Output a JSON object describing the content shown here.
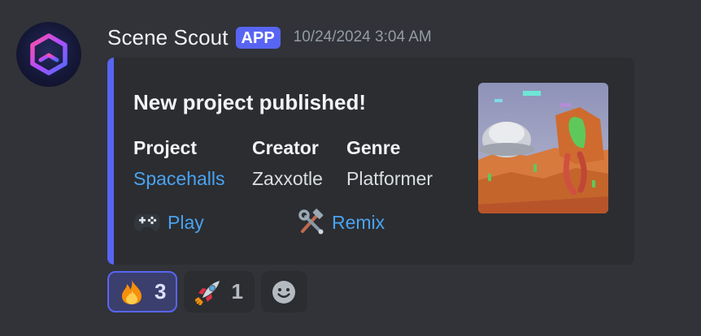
{
  "message": {
    "username": "Scene Scout",
    "badge": "APP",
    "timestamp": "10/24/2024 3:04 AM",
    "avatar_icon": "cube-hexagon-icon"
  },
  "embed": {
    "accent_color": "#5865f2",
    "title": "New project published!",
    "fields": [
      {
        "name": "Project",
        "value": "Spacehalls"
      },
      {
        "name": "Creator",
        "value": "Zaxxotle"
      },
      {
        "name": "Genre",
        "value": "Platformer"
      }
    ],
    "actions": [
      {
        "icon": "game-controller-icon",
        "label": "Play"
      },
      {
        "icon": "hammer-wrench-icon",
        "label": "Remix"
      }
    ],
    "thumbnail": "game-scene-thumbnail"
  },
  "reactions": [
    {
      "emoji": "fire-icon",
      "count": "3",
      "active": true
    },
    {
      "emoji": "rocket-icon",
      "count": "1",
      "active": false
    }
  ],
  "add_reaction": {
    "icon": "smiley-icon"
  }
}
